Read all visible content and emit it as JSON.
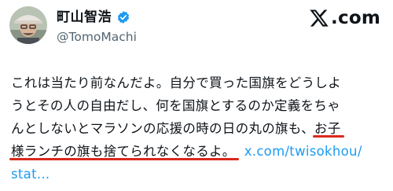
{
  "author": {
    "display_name": "町山智浩",
    "handle": "@TomoMachi",
    "verified": true
  },
  "brand": {
    "label": ".com"
  },
  "tweet": {
    "line1": "これは当たり前なんだよ。自分で買った国旗をどうしよ",
    "line2": "うとその人の自由だし、何を国旗とするのか定義をちゃ",
    "line3_plain": "んとしないとマラソンの応援の時の日の丸の旗も、",
    "line3_underlined": "お子",
    "line4_underlined": "様ランチの旗も捨てられなくなるよ。",
    "line4_link": "x.com/twisokhou/",
    "line5_link": "stat..."
  },
  "colors": {
    "link": "#1d9bf0",
    "underline": "#d9291c",
    "verified_badge": "#1d9bf0"
  }
}
